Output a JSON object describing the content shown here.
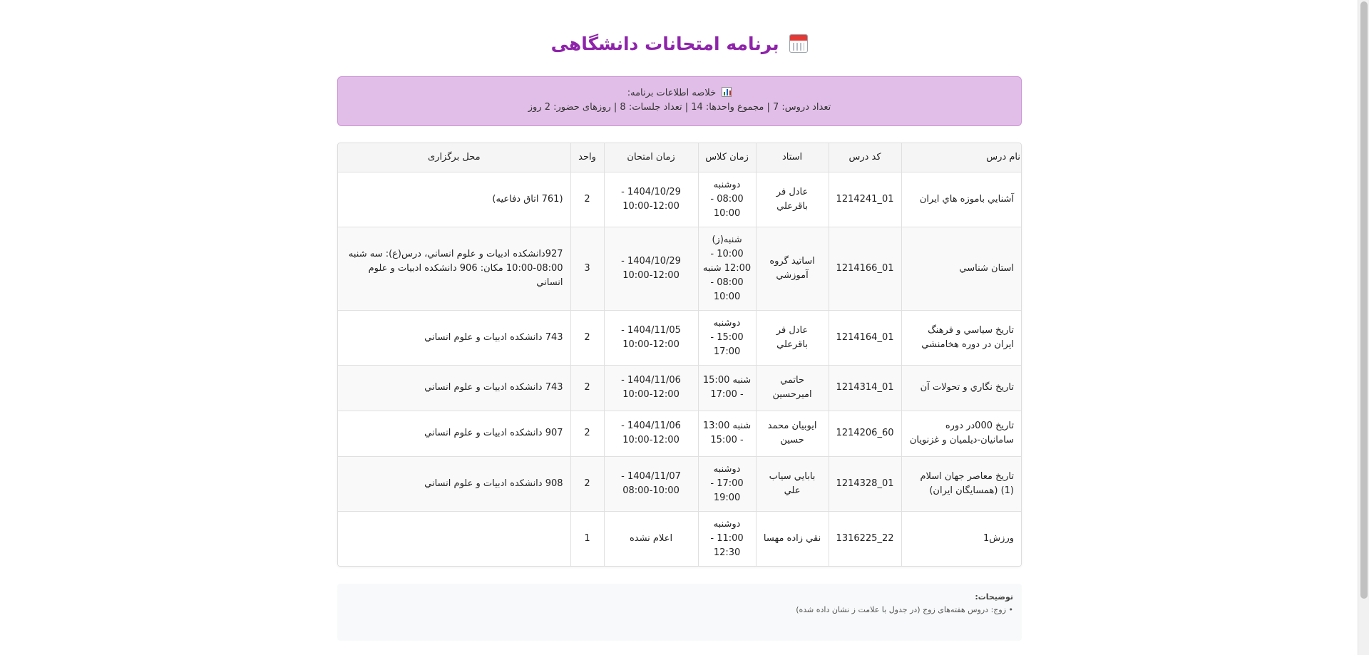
{
  "title": "برنامه امتحانات دانشگاهی",
  "summary": {
    "label": "خلاصه اطلاعات برنامه:",
    "stats": "تعداد دروس: 7 | مجموع واحدها: 14 | تعداد جلسات: 8 | روزهای حضور: 2 روز"
  },
  "table": {
    "headers": {
      "name": "نام درس",
      "code": "کد درس",
      "professor": "استاد",
      "class_time": "زمان کلاس",
      "exam_time": "زمان امتحان",
      "unit": "واحد",
      "location": "محل برگزاری"
    },
    "rows": [
      {
        "name": "آشنايي باموزه هاي ايران",
        "code": "01_1214241",
        "professor": "عادل فر باقرعلي",
        "class_time": "دوشنبه 08:00 - 10:00",
        "exam_time": "1404/10/29 - 10:00-12:00",
        "unit": "2",
        "location": "(761 اتاق دفاعيه)"
      },
      {
        "name": "استان شناسي",
        "code": "01_1214166",
        "professor": "اساتيد گروه آموزشي",
        "class_time": "شنبه(ز) 10:00 - 12:00 شنبه 08:00 - 10:00",
        "exam_time": "1404/10/29 - 10:00-12:00",
        "unit": "3",
        "location": "927دانشکده ادبيات و علوم انساني، درس(ع): سه شنبه 08:00-10:00 مکان: 906 دانشکده ادبيات و علوم انساني"
      },
      {
        "name": "تاريخ سياسي و فرهنگ ايران در دوره هخامنشي",
        "code": "01_1214164",
        "professor": "عادل فر باقرعلي",
        "class_time": "دوشنبه 15:00 - 17:00",
        "exam_time": "1404/11/05 - 10:00-12:00",
        "unit": "2",
        "location": "743 دانشکده ادبيات و علوم انساني"
      },
      {
        "name": "تاريخ نگاري و تحولات آن",
        "code": "01_1214314",
        "professor": "حاتمي اميرحسين",
        "class_time": "شنبه 15:00 - 17:00",
        "exam_time": "1404/11/06 - 10:00-12:00",
        "unit": "2",
        "location": "743 دانشکده ادبيات و علوم انساني"
      },
      {
        "name": "تاريخ 000در دوره سامانيان-ديلميان و غزنويان",
        "code": "60_1214206",
        "professor": "ايوبيان محمد حسين",
        "class_time": "شنبه 13:00 - 15:00",
        "exam_time": "1404/11/06 - 10:00-12:00",
        "unit": "2",
        "location": "907 دانشکده ادبيات و علوم انساني"
      },
      {
        "name": "تاريخ معاصر جهان اسلام (1) (همسايگان ايران)",
        "code": "01_1214328",
        "professor": "بابايي سياب علي",
        "class_time": "دوشنبه 17:00 - 19:00",
        "exam_time": "1404/11/07 - 08:00-10:00",
        "unit": "2",
        "location": "908 دانشکده ادبيات و علوم انساني"
      },
      {
        "name": "ورزش1",
        "code": "22_1316225",
        "professor": "نقي زاده مهسا",
        "class_time": "دوشنبه 11:00 - 12:30",
        "exam_time": "اعلام نشده",
        "unit": "1",
        "location": ""
      }
    ]
  },
  "notes": {
    "title": "توضیحات:",
    "line1": "• زوج: دروس هفته‌های زوج (در جدول با علامت ز نشان داده شده)"
  },
  "colors": {
    "title": "#8e24aa",
    "summary_bg": "#e1bee7"
  },
  "icons": {
    "title": "calendar-icon",
    "summary": "bar-chart-icon"
  }
}
